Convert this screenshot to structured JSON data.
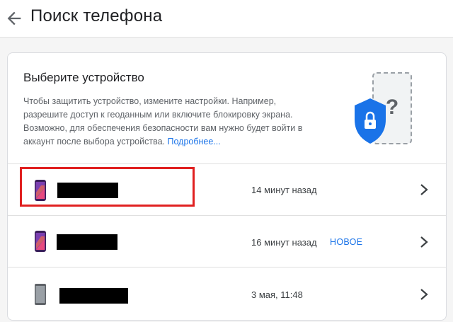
{
  "header": {
    "title": "Поиск телефона",
    "back_icon": "arrow-left-icon"
  },
  "intro": {
    "title": "Выберите устройство",
    "text": "Чтобы защитить устройство, измените настройки. Например, разрешите доступ к геоданным или включите блокировку экрана. Возможно, для обеспечения безопасности вам нужно будет войти в аккаунт после выбора устройства.",
    "link": "Подробнее..."
  },
  "devices": [
    {
      "time": "14 минут назад",
      "badge": ""
    },
    {
      "time": "16 минут назад",
      "badge": "НОВОЕ"
    },
    {
      "time": "3 мая, 11:48",
      "badge": ""
    }
  ],
  "colors": {
    "accent": "#1a73e8",
    "shield": "#1a73e8",
    "highlight": "#e02020"
  }
}
